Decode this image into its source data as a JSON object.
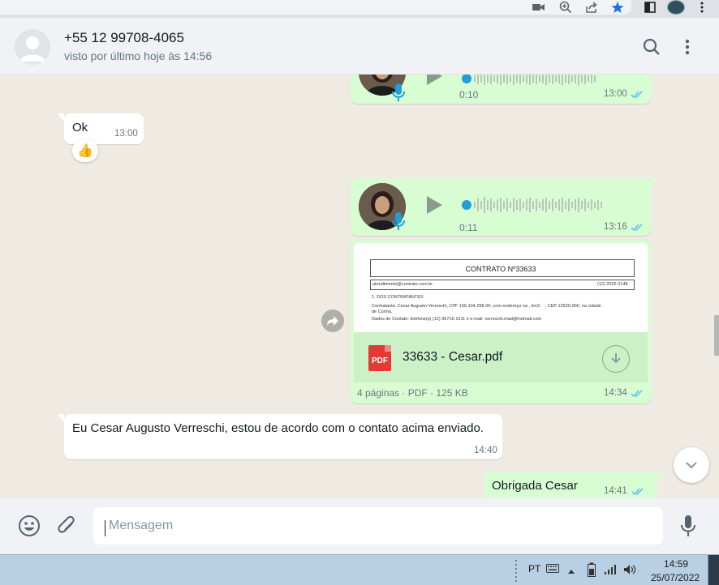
{
  "header": {
    "contact_name": "+55 12 99708-4065",
    "contact_status": "visto por último hoje às 14:56"
  },
  "messages": {
    "voice1": {
      "duration": "0:10",
      "time": "13:00"
    },
    "ok": {
      "text": "Ok",
      "time": "13:00",
      "reaction": "👍"
    },
    "voice2": {
      "duration": "0:11",
      "time": "13:16"
    },
    "document": {
      "preview_title": "CONTRATO Nº33633",
      "preview_email": "atendimento@contrato.com.br",
      "preview_phone": "(12) 2022-2148",
      "preview_section": "1. DOS CONTRATANTES",
      "preview_line1": "Contratante: Cesar Augusto Verreschi, CPF 166.104.298-00, com endereço na , km3 · ·, CEP 12530-000, na cidade",
      "preview_line1b": "de Cunha.",
      "preview_line2": "Dados de Contato: telefone(s) (12) 99716-1611 e e-mail: verreschi.mad@hotmail.com",
      "pdf_label": "PDF",
      "file_name": "33633 - Cesar.pdf",
      "meta": "4 páginas · PDF · 125 KB",
      "time": "14:34"
    },
    "agreement": {
      "text": "Eu Cesar Augusto Verreschi, estou de acordo com o contato acima enviado.",
      "time": "14:40"
    },
    "thanks": {
      "text": "Obrigada Cesar",
      "time": "14:41"
    }
  },
  "composer": {
    "placeholder": "Mensagem"
  },
  "taskbar": {
    "language": "PT",
    "time": "14:59",
    "date": "25/07/2022"
  },
  "colors": {
    "bubble_out": "#d9fdd3",
    "bubble_in": "#ffffff",
    "chat_bg": "#efeae2",
    "tick_read": "#53bdeb",
    "voice_accent": "#1f9ed9"
  }
}
